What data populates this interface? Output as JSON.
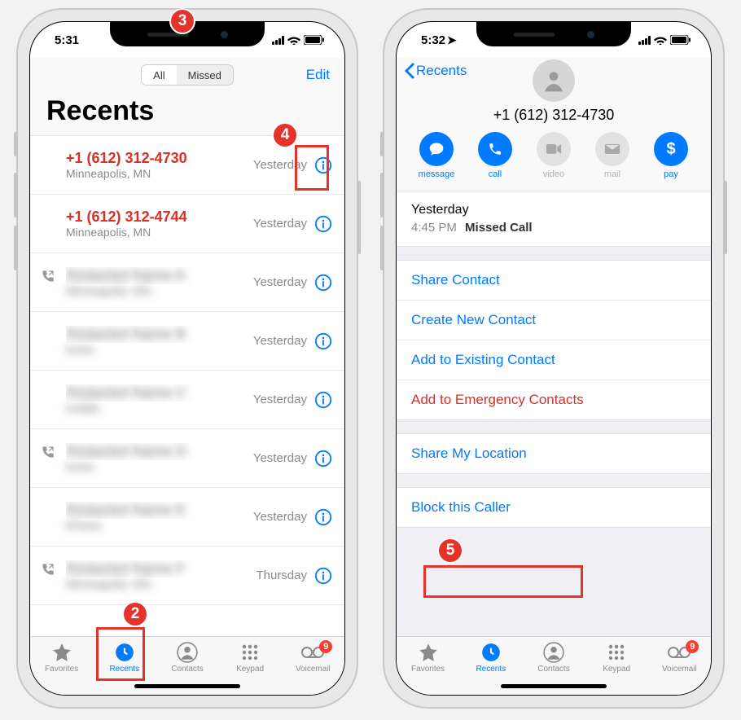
{
  "left": {
    "status_time": "5:31",
    "segmented": {
      "all": "All",
      "missed": "Missed"
    },
    "edit": "Edit",
    "title": "Recents",
    "rows": [
      {
        "title": "+1 (612) 312-4730",
        "sub": "Minneapolis, MN",
        "time": "Yesterday",
        "missed": true,
        "outgoing": false,
        "blur": false
      },
      {
        "title": "+1 (612) 312-4744",
        "sub": "Minneapolis, MN",
        "time": "Yesterday",
        "missed": true,
        "outgoing": false,
        "blur": false
      },
      {
        "title": "Redacted Name A",
        "sub": "Minneapolis, MN",
        "time": "Yesterday",
        "missed": false,
        "outgoing": true,
        "blur": true
      },
      {
        "title": "Redacted Name B",
        "sub": "home",
        "time": "Yesterday",
        "missed": false,
        "outgoing": false,
        "blur": true
      },
      {
        "title": "Redacted Name C",
        "sub": "mobile",
        "time": "Yesterday",
        "missed": false,
        "outgoing": false,
        "blur": true
      },
      {
        "title": "Redacted Name D",
        "sub": "home",
        "time": "Yesterday",
        "missed": false,
        "outgoing": true,
        "blur": true
      },
      {
        "title": "Redacted Name E",
        "sub": "iPhone",
        "time": "Yesterday",
        "missed": false,
        "outgoing": false,
        "blur": true
      },
      {
        "title": "Redacted Name F",
        "sub": "Minneapolis, MN",
        "time": "Thursday",
        "missed": false,
        "outgoing": true,
        "blur": true
      }
    ],
    "tabs": {
      "favorites": "Favorites",
      "recents": "Recents",
      "contacts": "Contacts",
      "keypad": "Keypad",
      "voicemail": "Voicemail",
      "voicemail_badge": "9"
    }
  },
  "right": {
    "status_time": "5:32",
    "back_label": "Recents",
    "phone_number": "+1 (612) 312-4730",
    "actions": {
      "message": "message",
      "call": "call",
      "video": "video",
      "mail": "mail",
      "pay": "pay"
    },
    "call_log": {
      "day": "Yesterday",
      "time": "4:45 PM",
      "type": "Missed Call"
    },
    "cells": {
      "share_contact": "Share Contact",
      "create_new": "Create New Contact",
      "add_existing": "Add to Existing Contact",
      "add_emergency": "Add to Emergency Contacts",
      "share_location": "Share My Location",
      "block": "Block this Caller"
    },
    "tabs": {
      "favorites": "Favorites",
      "recents": "Recents",
      "contacts": "Contacts",
      "keypad": "Keypad",
      "voicemail": "Voicemail",
      "voicemail_badge": "9"
    }
  },
  "annotations": {
    "n2": "2",
    "n3": "3",
    "n4": "4",
    "n5": "5"
  }
}
